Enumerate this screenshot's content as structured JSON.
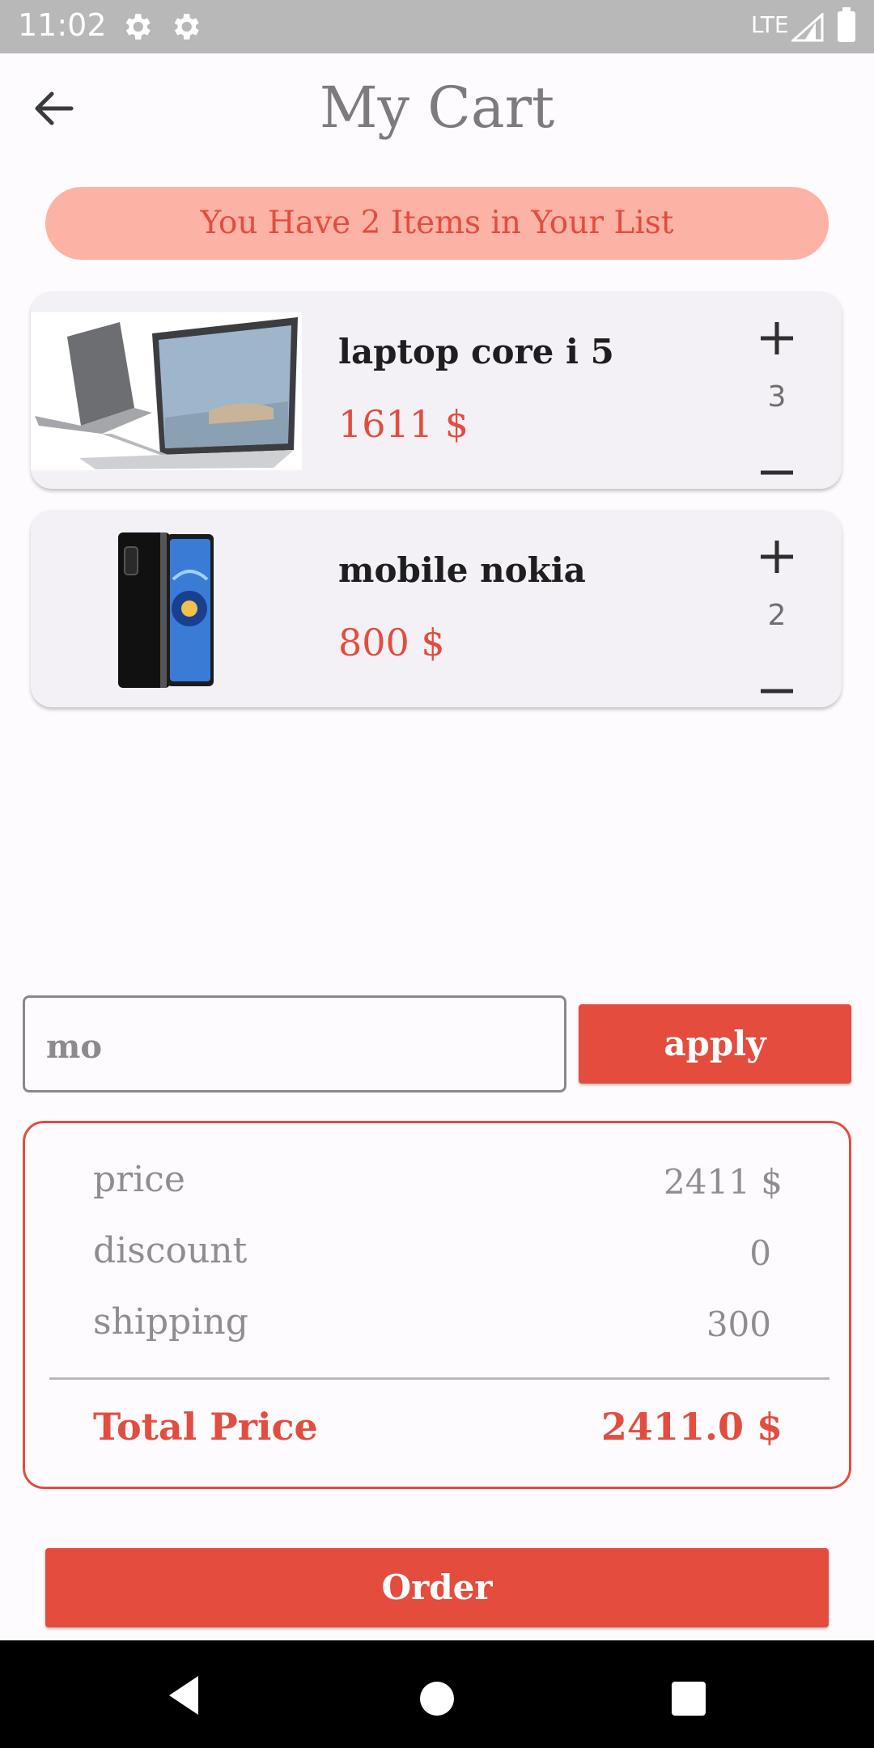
{
  "status_bar": {
    "time": "11:02",
    "network": "LTE",
    "icons": [
      "settings-gear-icon",
      "settings-gear-icon",
      "signal-icon",
      "battery-icon"
    ]
  },
  "header": {
    "title": "My Cart",
    "back_icon": "arrow-back-icon"
  },
  "banner": {
    "text": "You Have 2 Items in Your List"
  },
  "cart_items": [
    {
      "name": "laptop core i 5",
      "price": "1611 $",
      "quantity": "3",
      "image": "laptop-image"
    },
    {
      "name": "mobile nokia",
      "price": "800 $",
      "quantity": "2",
      "image": "phone-image"
    }
  ],
  "coupon": {
    "value": "mo",
    "apply_label": "apply"
  },
  "summary": {
    "price_label": "price",
    "price_value": "2411 $",
    "discount_label": "discount",
    "discount_value": "0",
    "shipping_label": "shipping",
    "shipping_value": "300",
    "total_label": "Total Price",
    "total_value": "2411.0 $"
  },
  "order_label": "Order",
  "colors": {
    "accent": "#e44c3d",
    "banner_bg": "#fcb2a5",
    "card_bg": "#f4f1f6",
    "status_bar": "#b9b8b9"
  }
}
